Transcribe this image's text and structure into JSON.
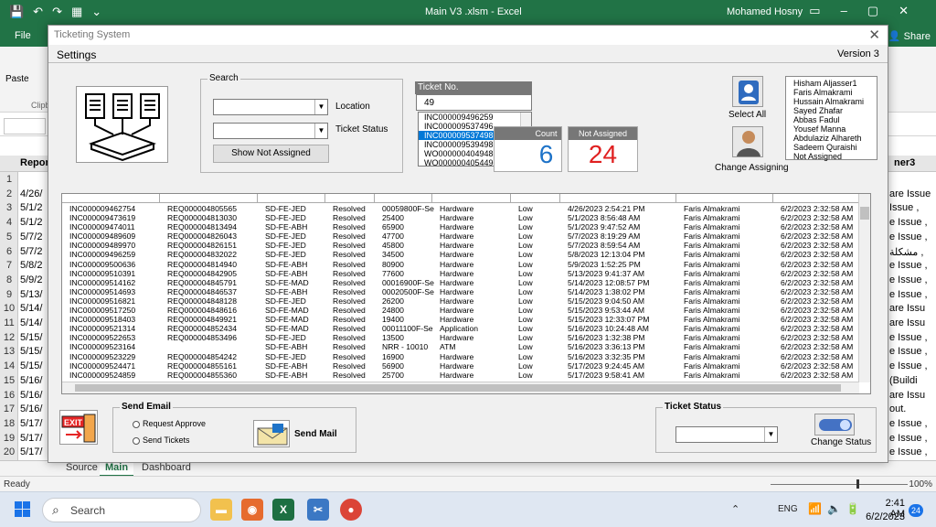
{
  "excel": {
    "doc_title": "Main V3 .xlsm  -  Excel",
    "user": "Mohamed Hosny",
    "file_tab": "File",
    "share": "Share",
    "paste": "Paste",
    "clipboard": "Clipb",
    "column_left": "Repor",
    "column_right": "ner3",
    "rows": [
      {
        "n": "2",
        "left": "4/26/",
        "right": "are Issue"
      },
      {
        "n": "3",
        "left": "5/1/2",
        "right": "Issue ,"
      },
      {
        "n": "4",
        "left": "5/1/2",
        "right": "e Issue ,"
      },
      {
        "n": "5",
        "left": "5/7/2",
        "right": "e Issue ,"
      },
      {
        "n": "6",
        "left": "5/7/2",
        "right": "مشكلة ,"
      },
      {
        "n": "7",
        "left": "5/8/2",
        "right": "e Issue ,"
      },
      {
        "n": "8",
        "left": "5/9/2",
        "right": "e Issue ,"
      },
      {
        "n": "9",
        "left": "5/13/",
        "right": "e Issue ,"
      },
      {
        "n": "10",
        "left": "5/14/",
        "right": "are Issu"
      },
      {
        "n": "11",
        "left": "5/14/",
        "right": "are Issu"
      },
      {
        "n": "12",
        "left": "5/15/",
        "right": "e Issue ,"
      },
      {
        "n": "13",
        "left": "5/15/",
        "right": "e Issue ,"
      },
      {
        "n": "14",
        "left": "5/15/",
        "right": "e Issue ,"
      },
      {
        "n": "15",
        "left": "5/16/",
        "right": "(Buildi"
      },
      {
        "n": "16",
        "left": "5/16/",
        "right": "are Issu"
      },
      {
        "n": "17",
        "left": "5/16/",
        "right": "out."
      },
      {
        "n": "18",
        "left": "5/17/",
        "right": "e Issue ,"
      },
      {
        "n": "19",
        "left": "5/17/",
        "right": "e Issue ,"
      },
      {
        "n": "20",
        "left": "5/17/",
        "right": "e Issue ,"
      },
      {
        "n": "21",
        "left": "5/17/",
        "right": "المشكلة ,"
      }
    ],
    "first_row_num": "1",
    "sheet_tabs": [
      "Source",
      "Main",
      "Dashboard"
    ],
    "status_ready": "Ready",
    "zoom": "100%"
  },
  "taskbar": {
    "search": "Search",
    "lang": "ENG",
    "time": "2:41 AM",
    "date": "6/2/2023",
    "notifications": "24"
  },
  "dialog": {
    "title": "Ticketing System",
    "settings": "Settings",
    "version": "Version 3",
    "search_group": "Search",
    "location_label": "Location",
    "ticket_status_label": "Ticket Status",
    "show_not_assigned": "Show Not Assigned",
    "ticket_no_caption": "Ticket No.",
    "ticket_no_value": "49",
    "ticket_list": [
      "INC000009496259",
      "INC000009537496",
      "INC000009537498",
      "INC000009539498",
      "WO0000004049481",
      "WO0000004054498"
    ],
    "ticket_selected_index": 2,
    "count_caption": "Count",
    "count_value": "6",
    "not_assigned_caption": "Not Assigned Count",
    "not_assigned_value": "24",
    "select_all": "Select All",
    "change_assigning": "Change Assigning",
    "assignees": [
      "Hisham Aljasser1",
      "Faris Almakrami",
      "Hussain Almakrami",
      "Sayed Zhafar",
      "Abbas Fadul",
      "Yousef Manna",
      "Abdulaziz Alhareth",
      "Sadeem Quraishi",
      "Not Assigned"
    ],
    "grid_rows": [
      [
        "INC000009462754",
        "REQ000004805565",
        "SD-FE-JED",
        "Resolved",
        "00059800F-Se",
        "Hardware",
        "Low",
        "4/26/2023 2:54:21 PM",
        "Faris Almakrami",
        "6/2/2023 2:32:58 AM"
      ],
      [
        "INC000009473619",
        "REQ000004813030",
        "SD-FE-JED",
        "Resolved",
        "25400",
        "Hardware",
        "Low",
        "5/1/2023 8:56:48 AM",
        "Faris Almakrami",
        "6/2/2023 2:32:58 AM"
      ],
      [
        "INC000009474011",
        "REQ000004813494",
        "SD-FE-ABH",
        "Resolved",
        "65900",
        "Hardware",
        "Low",
        "5/1/2023 9:47:52 AM",
        "Faris Almakrami",
        "6/2/2023 2:32:58 AM"
      ],
      [
        "INC000009489609",
        "REQ000004826043",
        "SD-FE-JED",
        "Resolved",
        "47700",
        "Hardware",
        "Low",
        "5/7/2023 8:19:29 AM",
        "Faris Almakrami",
        "6/2/2023 2:32:58 AM"
      ],
      [
        "INC000009489970",
        "REQ000004826151",
        "SD-FE-JED",
        "Resolved",
        "45800",
        "Hardware",
        "Low",
        "5/7/2023 8:59:54 AM",
        "Faris Almakrami",
        "6/2/2023 2:32:58 AM"
      ],
      [
        "INC000009496259",
        "REQ000004832022",
        "SD-FE-JED",
        "Resolved",
        "34500",
        "Hardware",
        "Low",
        "5/8/2023 12:13:04 PM",
        "Faris Almakrami",
        "6/2/2023 2:32:58 AM"
      ],
      [
        "INC000009500636",
        "REQ000004814940",
        "SD-FE-ABH",
        "Resolved",
        "80900",
        "Hardware",
        "Low",
        "5/9/2023 1:52:25 PM",
        "Faris Almakrami",
        "6/2/2023 2:32:58 AM"
      ],
      [
        "INC000009510391",
        "REQ000004842905",
        "SD-FE-ABH",
        "Resolved",
        "77600",
        "Hardware",
        "Low",
        "5/13/2023 9:41:37 AM",
        "Faris Almakrami",
        "6/2/2023 2:32:58 AM"
      ],
      [
        "INC000009514162",
        "REQ000004845791",
        "SD-FE-MAD",
        "Resolved",
        "00016900F-Se",
        "Hardware",
        "Low",
        "5/14/2023 12:08:57 PM",
        "Faris Almakrami",
        "6/2/2023 2:32:58 AM"
      ],
      [
        "INC000009514693",
        "REQ000004846537",
        "SD-FE-ABH",
        "Resolved",
        "00020500F-Se",
        "Hardware",
        "Low",
        "5/14/2023 1:38:02 PM",
        "Faris Almakrami",
        "6/2/2023 2:32:58 AM"
      ],
      [
        "INC000009516821",
        "REQ000004848128",
        "SD-FE-JED",
        "Resolved",
        "26200",
        "Hardware",
        "Low",
        "5/15/2023 9:04:50 AM",
        "Faris Almakrami",
        "6/2/2023 2:32:58 AM"
      ],
      [
        "INC000009517250",
        "REQ000004848616",
        "SD-FE-MAD",
        "Resolved",
        "24800",
        "Hardware",
        "Low",
        "5/15/2023 9:53:44 AM",
        "Faris Almakrami",
        "6/2/2023 2:32:58 AM"
      ],
      [
        "INC000009518403",
        "REQ000004849921",
        "SD-FE-MAD",
        "Resolved",
        "19400",
        "Hardware",
        "Low",
        "5/15/2023 12:33:07 PM",
        "Faris Almakrami",
        "6/2/2023 2:32:58 AM"
      ],
      [
        "INC000009521314",
        "REQ000004852434",
        "SD-FE-MAD",
        "Resolved",
        "00011100F-Se",
        "Application",
        "Low",
        "5/16/2023 10:24:48 AM",
        "Faris Almakrami",
        "6/2/2023 2:32:58 AM"
      ],
      [
        "INC000009522653",
        "REQ000004853496",
        "SD-FE-JED",
        "Resolved",
        "13500",
        "Hardware",
        "Low",
        "5/16/2023 1:32:38 PM",
        "Faris Almakrami",
        "6/2/2023 2:32:58 AM"
      ],
      [
        "INC000009523164",
        "",
        "SD-FE-ABH",
        "Resolved",
        "NRR - 10010",
        "ATM",
        "Low",
        "5/16/2023 3:36:13 PM",
        "Faris Almakrami",
        "6/2/2023 2:32:58 AM"
      ],
      [
        "INC000009523229",
        "REQ000004854242",
        "SD-FE-JED",
        "Resolved",
        "16900",
        "Hardware",
        "Low",
        "5/16/2023 3:32:35 PM",
        "Faris Almakrami",
        "6/2/2023 2:32:58 AM"
      ],
      [
        "INC000009524471",
        "REQ000004855161",
        "SD-FE-ABH",
        "Resolved",
        "56900",
        "Hardware",
        "Low",
        "5/17/2023 9:24:45 AM",
        "Faris Almakrami",
        "6/2/2023 2:32:58 AM"
      ],
      [
        "INC000009524859",
        "REQ000004855360",
        "SD-FE-ABH",
        "Resolved",
        "25700",
        "Hardware",
        "Low",
        "5/17/2023 9:58:41 AM",
        "Faris Almakrami",
        "6/2/2023 2:32:58 AM"
      ]
    ],
    "send_email_group": "Send Email",
    "request_approve": "Request Approve",
    "send_tickets": "Send Tickets",
    "send_mail": "Send Mail",
    "exit": "EXIT",
    "ticket_status_group": "Ticket Status",
    "change_status": "Change Status"
  }
}
